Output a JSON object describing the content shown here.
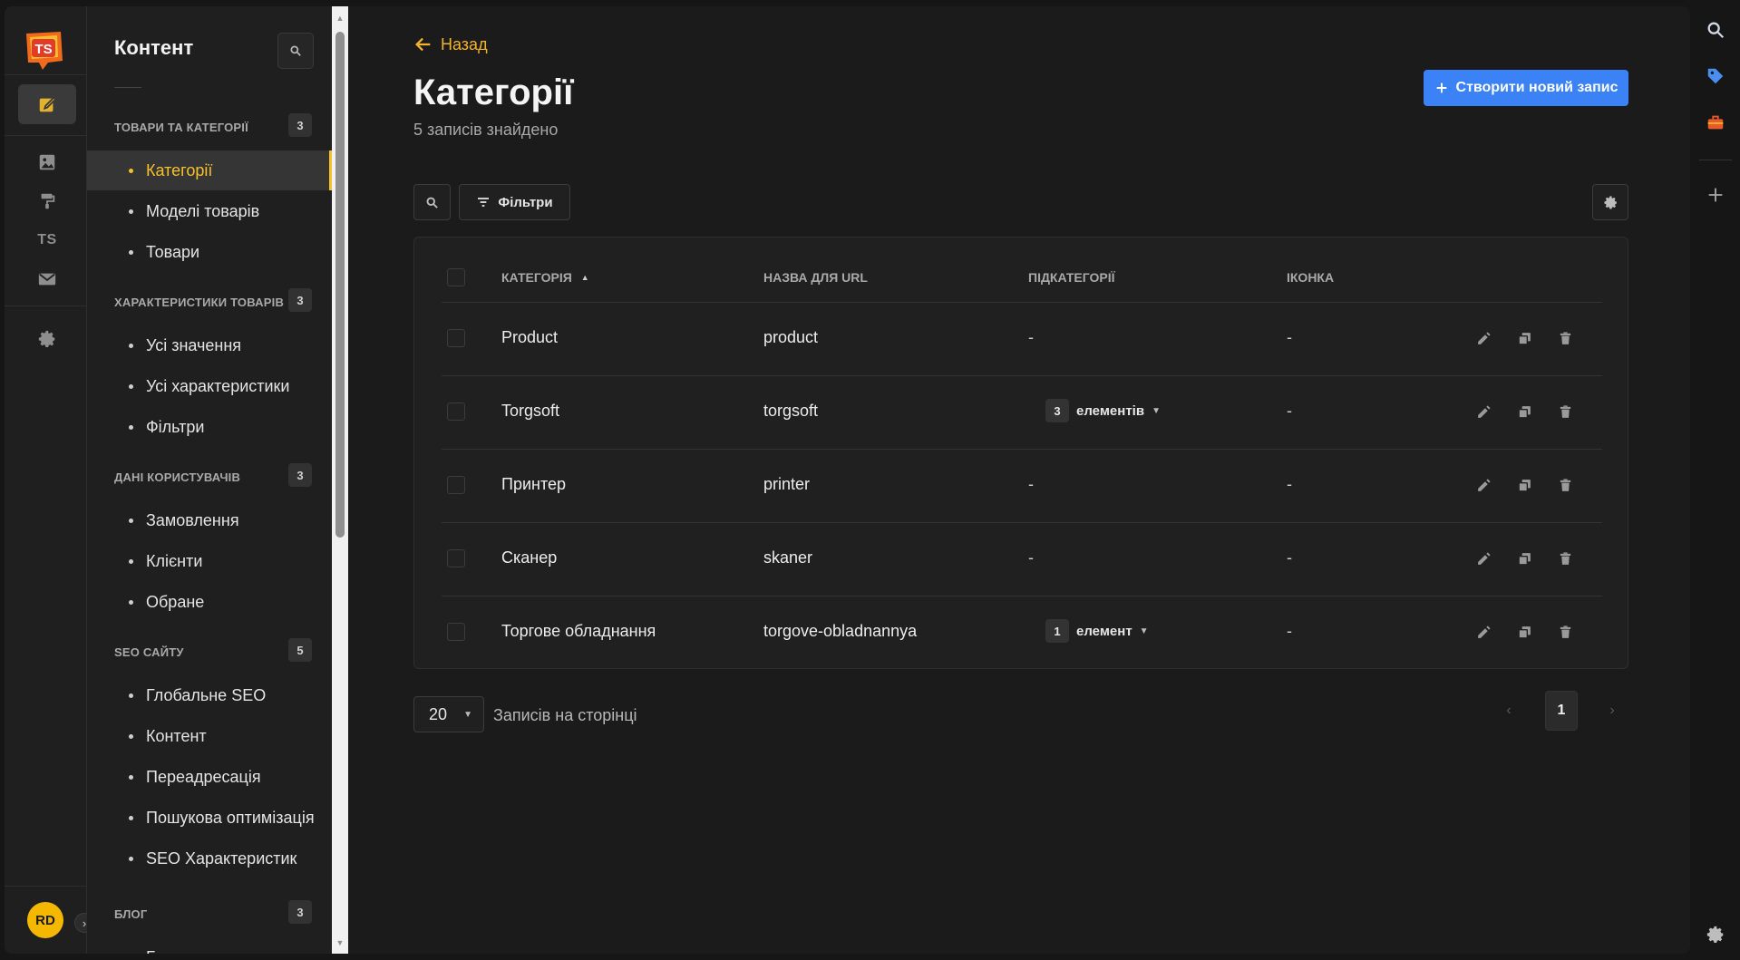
{
  "rail": {
    "logo_text": "TS",
    "avatar_initials": "RD",
    "items": [
      {
        "icon": "content-edit-icon",
        "active": true
      },
      {
        "icon": "media-image-icon",
        "active": false
      },
      {
        "icon": "paint-roller-icon",
        "active": false
      },
      {
        "icon": "ts-plugin-icon",
        "text": "TS",
        "active": false
      },
      {
        "icon": "mail-icon",
        "active": false
      },
      {
        "icon": "settings-gear-icon",
        "active": false
      }
    ]
  },
  "sidebar": {
    "title": "Контент",
    "sections": [
      {
        "label": "Товари та категорії",
        "count": "3",
        "items": [
          "Категорії",
          "Моделі товарів",
          "Товари"
        ]
      },
      {
        "label": "Характеристики товарів",
        "count": "3",
        "items": [
          "Усі значення",
          "Усі характеристики",
          "Фільтри"
        ]
      },
      {
        "label": "Дані користувачів",
        "count": "3",
        "items": [
          "Замовлення",
          "Клієнти",
          "Обране"
        ]
      },
      {
        "label": "SEO сайту",
        "count": "5",
        "items": [
          "Глобальне SEO",
          "Контент",
          "Переадресація",
          "Пошукова оптимізація",
          "SEO Характеристик"
        ]
      },
      {
        "label": "Блог",
        "count": "3",
        "items": [
          "Блог"
        ]
      }
    ],
    "active_item": "Категорії"
  },
  "main": {
    "back_label": "Назад",
    "title": "Категорії",
    "subtitle": "5 записів знайдено",
    "create_label": "Створити новий запис",
    "filters_label": "Фільтри",
    "columns": [
      "Категорія",
      "Назва для URL",
      "Підкатегорії",
      "Іконка"
    ],
    "rows": [
      {
        "name": "Product",
        "slug": "product",
        "sub": "-",
        "sub_count": null,
        "sub_label": null,
        "icon": "-"
      },
      {
        "name": "Torgsoft",
        "slug": "torgsoft",
        "sub": null,
        "sub_count": "3",
        "sub_label": "елементів",
        "icon": "-"
      },
      {
        "name": "Принтер",
        "slug": "printer",
        "sub": "-",
        "sub_count": null,
        "sub_label": null,
        "icon": "-"
      },
      {
        "name": "Сканер",
        "slug": "skaner",
        "sub": "-",
        "sub_count": null,
        "sub_label": null,
        "icon": "-"
      },
      {
        "name": "Торгове обладнання",
        "slug": "torgove-obladnannya",
        "sub": null,
        "sub_count": "1",
        "sub_label": "елемент",
        "icon": "-"
      }
    ],
    "per_page": "20",
    "per_page_label": "Записів на сторінці",
    "current_page": "1"
  },
  "colors": {
    "accent": "#f5c02d",
    "primary": "#3b82f6",
    "background": "#1b1b1b"
  }
}
